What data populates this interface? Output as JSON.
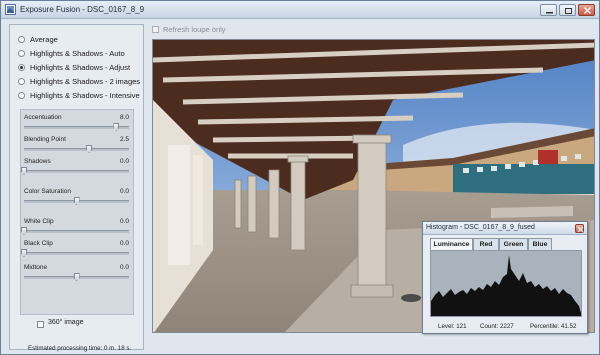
{
  "window": {
    "title": "Exposure Fusion - DSC_0167_8_9",
    "controls": [
      "minimize-icon",
      "restore-icon",
      "close-icon"
    ]
  },
  "modes": [
    {
      "label": "Average",
      "selected": false
    },
    {
      "label": "Highlights & Shadows - Auto",
      "selected": false
    },
    {
      "label": "Highlights & Shadows - Adjust",
      "selected": true
    },
    {
      "label": "Highlights & Shadows - 2 images",
      "selected": false
    },
    {
      "label": "Highlights & Shadows - Intensive",
      "selected": false
    }
  ],
  "sliders": [
    {
      "label": "Accentuation",
      "value": "8.0",
      "level": 0.88
    },
    {
      "label": "Blending Point",
      "value": "2.5",
      "level": 0.62
    },
    {
      "label": "Shadows",
      "value": "0.0",
      "level": 0.0
    },
    {
      "label": "Color Saturation",
      "value": "0.0",
      "level": 0.5
    },
    {
      "label": "White Clip",
      "value": "0.0",
      "level": 0.0
    },
    {
      "label": "Black Clip",
      "value": "0.0",
      "level": 0.0
    },
    {
      "label": "Midtone",
      "value": "0.0",
      "level": 0.5
    }
  ],
  "option_360": {
    "label": "360° image",
    "checked": false
  },
  "estimate": "Estimated processing time: 0 m. 18 s.",
  "refresh_loupe": {
    "label": "Refresh loupe only",
    "checked": false
  },
  "histogram": {
    "title": "Histogram - DSC_0167_8_9_fused",
    "tabs": [
      "Luminance",
      "Red",
      "Green",
      "Blue"
    ],
    "active_tab": "Luminance",
    "level": "Level: 121",
    "count": "Count: 2227",
    "percentile": "Percentile: 41.52"
  },
  "colors": {
    "accent": "#c9d6e4",
    "panel": "#e7ecf1",
    "histogram_fill": "#111111"
  }
}
